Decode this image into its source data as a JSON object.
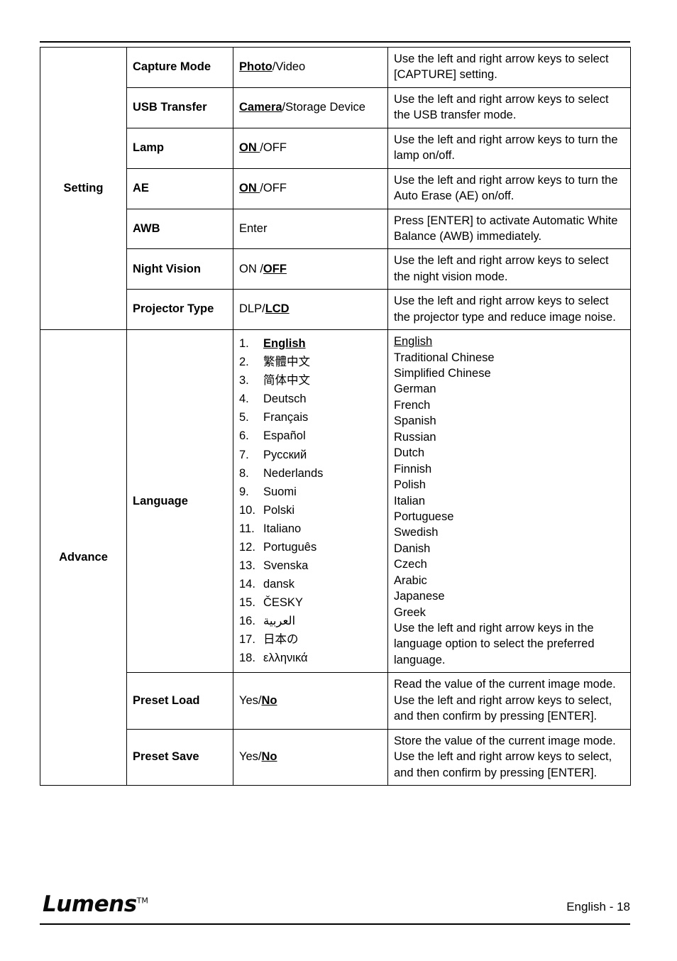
{
  "document": {
    "page_label": "English - 18",
    "logo_text": "Lumens",
    "logo_tm": "TM"
  },
  "table": {
    "sections": [
      {
        "name": "Setting"
      },
      {
        "name": "Advance"
      }
    ],
    "rows": [
      {
        "section": "Setting",
        "param": "Capture Mode",
        "value_bold": "Photo",
        "value_rest": "/Video",
        "description": "Use the left and right arrow keys to select [CAPTURE] setting."
      },
      {
        "section": "",
        "param": "USB Transfer",
        "value_bold": "Camera",
        "value_rest": "/Storage Device",
        "description": "Use the left and right arrow keys to select the USB transfer mode."
      },
      {
        "section": "",
        "param": "Lamp",
        "value_bold": "ON ",
        "value_rest": "/OFF",
        "description": "Use the left and right arrow keys to turn the lamp on/off."
      },
      {
        "section": "",
        "param": "AE",
        "value_bold": "ON ",
        "value_rest": "/OFF",
        "description": "Use the left and right arrow keys to turn the Auto Erase (AE) on/off."
      },
      {
        "section": "",
        "param": "AWB",
        "value_bold": "",
        "value_rest": "Enter",
        "description": "Press [ENTER] to activate Automatic White Balance (AWB) immediately."
      },
      {
        "section": "",
        "param": "Night Vision",
        "value_pre": "ON /",
        "value_bold": "OFF",
        "value_rest": "",
        "description": "Use the left and right arrow keys to select the night vision mode."
      },
      {
        "section": "",
        "param": "Projector Type",
        "value_pre": "DLP/",
        "value_bold": "LCD",
        "value_rest": "",
        "description": "Use the left and right arrow keys to select the projector type and reduce image noise."
      }
    ],
    "language_row": {
      "section": "Advance",
      "param": "Language",
      "options": [
        {
          "num": "1.",
          "name": "English",
          "selected": true,
          "script": "latin"
        },
        {
          "num": "2.",
          "name": "繁體中文",
          "selected": false,
          "script": "cjk"
        },
        {
          "num": "3.",
          "name": "简体中文",
          "selected": false,
          "script": "cjk"
        },
        {
          "num": "4.",
          "name": "Deutsch",
          "selected": false,
          "script": "latin"
        },
        {
          "num": "5.",
          "name": "Français",
          "selected": false,
          "script": "latin"
        },
        {
          "num": "6.",
          "name": "Español",
          "selected": false,
          "script": "latin"
        },
        {
          "num": "7.",
          "name": "Русский",
          "selected": false,
          "script": "latin"
        },
        {
          "num": "8.",
          "name": "Nederlands",
          "selected": false,
          "script": "latin"
        },
        {
          "num": "9.",
          "name": "Suomi",
          "selected": false,
          "script": "latin"
        },
        {
          "num": "10.",
          "name": "Polski",
          "selected": false,
          "script": "latin"
        },
        {
          "num": "11.",
          "name": "Italiano",
          "selected": false,
          "script": "latin"
        },
        {
          "num": "12.",
          "name": "Português",
          "selected": false,
          "script": "latin"
        },
        {
          "num": "13.",
          "name": "Svenska",
          "selected": false,
          "script": "latin"
        },
        {
          "num": "14.",
          "name": "dansk",
          "selected": false,
          "script": "latin"
        },
        {
          "num": "15.",
          "name": "ČESKY",
          "selected": false,
          "script": "latin"
        },
        {
          "num": "16.",
          "name": "العربية",
          "selected": false,
          "script": "rtl"
        },
        {
          "num": "17.",
          "name": "日本の",
          "selected": false,
          "script": "cjk"
        },
        {
          "num": "18.",
          "name": "ελληνικά",
          "selected": false,
          "script": "latin"
        }
      ],
      "description_names": [
        "English",
        "Traditional Chinese",
        "Simplified Chinese",
        "German",
        "French",
        "Spanish",
        "Russian",
        "Dutch",
        "Finnish",
        "Polish",
        "Italian",
        "Portuguese",
        "Swedish",
        "Danish",
        "Czech",
        "Arabic",
        "Japanese",
        "Greek"
      ],
      "description_tail": "Use the left and right arrow keys in the language option to select the preferred language."
    },
    "preset_rows": [
      {
        "param": "Preset Load",
        "value_pre": "Yes/",
        "value_bold": "No",
        "description": "Read the value of the current image mode. Use the left and right arrow keys to select, and then confirm by pressing [ENTER]."
      },
      {
        "param": "Preset Save",
        "value_pre": "Yes/",
        "value_bold": "No",
        "description": "Store the value of the current image mode. Use the left and right arrow keys to select, and then confirm by pressing [ENTER]."
      }
    ]
  }
}
